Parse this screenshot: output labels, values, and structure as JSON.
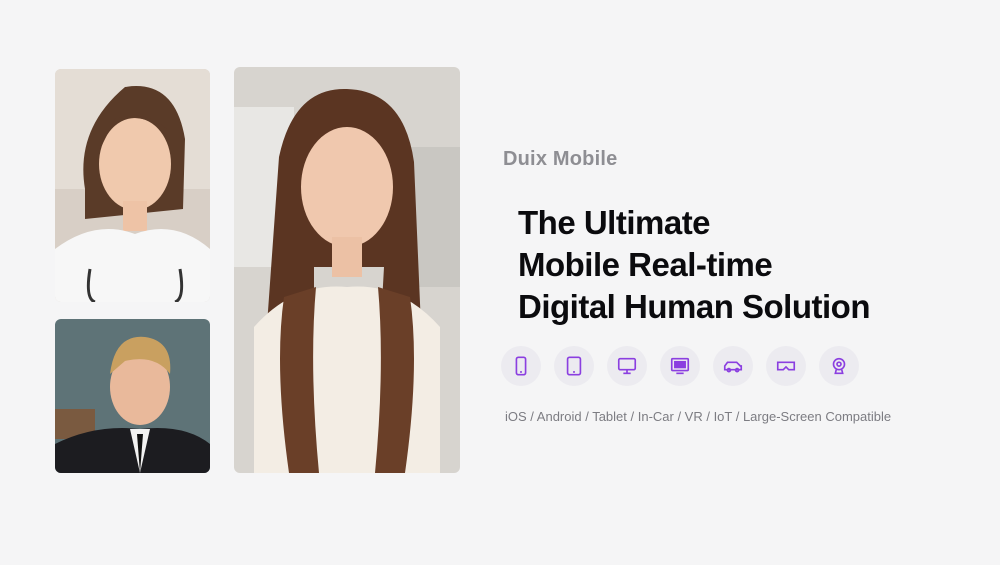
{
  "brand": "Duix Mobile",
  "headline": {
    "line1": "The Ultimate",
    "line2": "Mobile Real-time",
    "line3": "Digital Human Solution"
  },
  "devices": [
    "phone-icon",
    "tablet-icon",
    "desktop-icon",
    "monitor-icon",
    "car-icon",
    "vr-headset-icon",
    "webcam-icon"
  ],
  "compatibility": "iOS / Android / Tablet / In-Car / VR / IoT / Large-Screen Compatible",
  "colors": {
    "accent": "#8b3fe0",
    "icon_bg": "#ecebf0",
    "background": "#f5f5f6"
  }
}
